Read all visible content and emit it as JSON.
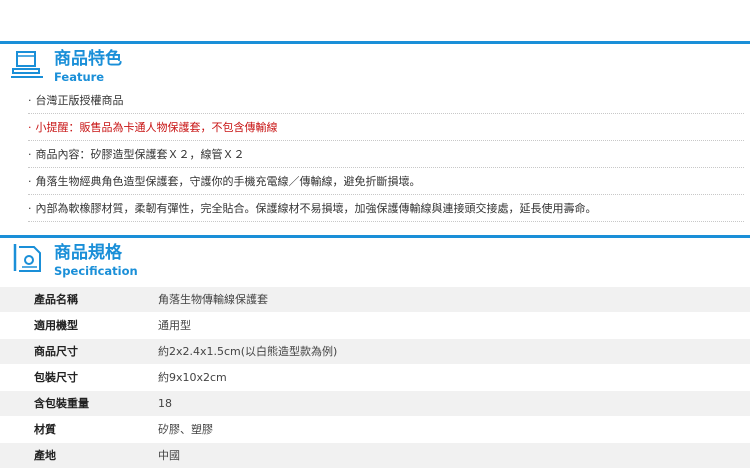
{
  "feature": {
    "title": "商品特色",
    "subtitle": "Feature",
    "items": [
      {
        "text": "台灣正版授權商品",
        "alert": false
      },
      {
        "text": "小提醒：販售品為卡通人物保護套，不包含傳輸線",
        "alert": true
      },
      {
        "text": "商品內容：矽膠造型保護套Ｘ２，線管Ｘ２",
        "alert": false
      },
      {
        "text": "角落生物經典角色造型保護套，守護你的手機充電線／傳輸線，避免折斷損壞。",
        "alert": false
      },
      {
        "text": "內部為軟橡膠材質，柔韌有彈性，完全貼合。保護線材不易損壞，加強保護傳輸線與連接頭交接處，延長使用壽命。",
        "alert": false
      }
    ]
  },
  "spec": {
    "title": "商品規格",
    "subtitle": "Specification",
    "rows": [
      {
        "key": "產品名稱",
        "value": "角落生物傳輸線保護套"
      },
      {
        "key": "適用機型",
        "value": "通用型"
      },
      {
        "key": "商品尺寸",
        "value": "約2x2.4x1.5cm(以白熊造型款為例)"
      },
      {
        "key": "包裝尺寸",
        "value": "約9x10x2cm"
      },
      {
        "key": "含包裝重量",
        "value": "18"
      },
      {
        "key": "材質",
        "value": "矽膠、塑膠"
      },
      {
        "key": "產地",
        "value": "中國"
      }
    ]
  },
  "colors": {
    "accent": "#1a8fd8",
    "alert": "#c81414",
    "row_shade": "#f1f1f1"
  },
  "icons": {
    "feature": "monitor-icon",
    "spec": "spec-sheet-icon"
  }
}
